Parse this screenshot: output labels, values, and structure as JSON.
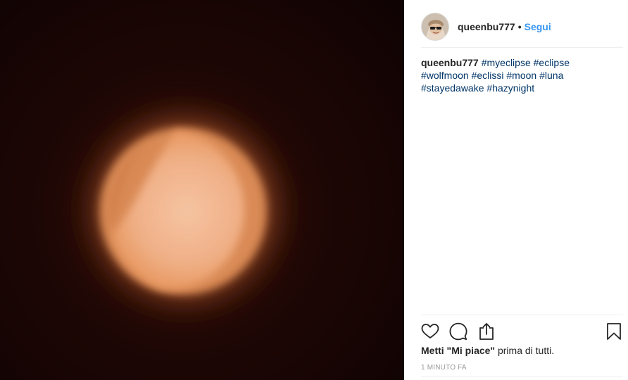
{
  "post": {
    "username": "queenbu777",
    "separator": "•",
    "follow_label": "Segui",
    "caption": {
      "username": "queenbu777",
      "hashtags": [
        "#myeclipse",
        "#eclipse",
        "#wolfmoon",
        "#eclissi",
        "#moon",
        "#luna",
        "#stayedawake",
        "#hazynight"
      ]
    },
    "likes": {
      "lead": "Metti \"Mi piace\"",
      "rest": " prima di tutti."
    },
    "timestamp": "1 minuto fa"
  },
  "icons": {
    "like": "heart-icon",
    "comment": "comment-icon",
    "share": "share-icon",
    "save": "bookmark-icon"
  },
  "colors": {
    "link_blue": "#3897f0",
    "hashtag_blue": "#003569",
    "text": "#262626",
    "muted": "#999999",
    "divider": "#efefef",
    "photo_background": "#140404",
    "moon_glow": "#e8965c"
  }
}
